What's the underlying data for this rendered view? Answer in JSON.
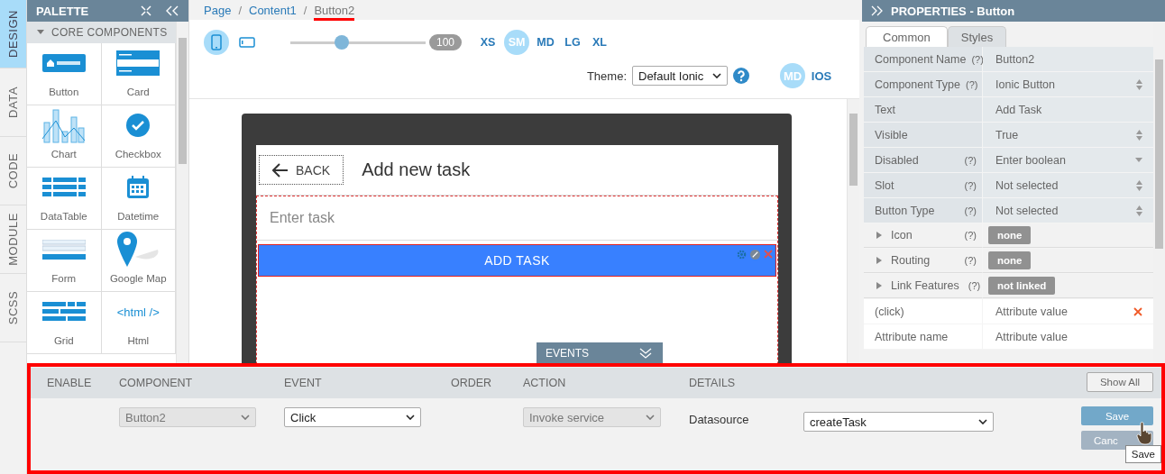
{
  "side_tabs": [
    {
      "label": "DESIGN",
      "selected": true
    },
    {
      "label": "DATA",
      "selected": false
    },
    {
      "label": "CODE",
      "selected": false
    },
    {
      "label": "MODULE",
      "selected": false
    },
    {
      "label": "SCSS",
      "selected": false
    }
  ],
  "palette": {
    "title": "PALETTE",
    "section": "CORE COMPONENTS",
    "items": [
      {
        "label": "Button",
        "kind": "button"
      },
      {
        "label": "Card",
        "kind": "card"
      },
      {
        "label": "Chart",
        "kind": "chart"
      },
      {
        "label": "Checkbox",
        "kind": "checkbox"
      },
      {
        "label": "DataTable",
        "kind": "datatable"
      },
      {
        "label": "Datetime",
        "kind": "datetime"
      },
      {
        "label": "Form",
        "kind": "form"
      },
      {
        "label": "Google Map",
        "kind": "map"
      },
      {
        "label": "Grid",
        "kind": "grid"
      },
      {
        "label": "Html",
        "kind": "html"
      }
    ],
    "html_icon_text": "<html />"
  },
  "breadcrumb": [
    {
      "label": "Page",
      "selected": false
    },
    {
      "separator": "/",
      "label": "Content1",
      "selected": false
    },
    {
      "separator": "/",
      "label": "Button2",
      "selected": true
    }
  ],
  "toolbar": {
    "zoom": {
      "level": 0.38,
      "reading": "100"
    },
    "sizes": [
      {
        "label": "XS",
        "selected": false
      },
      {
        "label": "SM",
        "selected": true
      },
      {
        "label": "MD",
        "selected": false
      },
      {
        "label": "LG",
        "selected": false
      },
      {
        "label": "XL",
        "selected": false
      }
    ],
    "theme_label": "Theme:",
    "theme": "Default Ionic",
    "modes": [
      {
        "label": "MD",
        "selected": true
      },
      {
        "label": "IOS",
        "selected": false
      }
    ]
  },
  "device": {
    "back": "BACK",
    "title": "Add new task",
    "placeholder": "Enter task",
    "button": "ADD TASK"
  },
  "events_tab": "EVENTS",
  "properties": {
    "title": "PROPERTIES - Button",
    "tabs": [
      {
        "label": "Common",
        "selected": true
      },
      {
        "label": "Styles",
        "selected": false
      }
    ],
    "rows": [
      {
        "name": "Component Name",
        "help": "(?)",
        "value": "Button2",
        "kind": "text"
      },
      {
        "name": "Component Type",
        "help": "(?)",
        "value": "Ionic Button",
        "kind": "select"
      },
      {
        "name": "Text",
        "value": "Add Task",
        "kind": "text"
      },
      {
        "name": "Visible",
        "value": "True",
        "kind": "select"
      },
      {
        "name": "Disabled",
        "help": "(?)",
        "value": "Enter boolean",
        "kind": "dropdown"
      },
      {
        "name": "Slot",
        "help": "(?)",
        "value": "Not selected",
        "kind": "select"
      },
      {
        "name": "Button Type",
        "help": "(?)",
        "value": "Not selected",
        "kind": "select"
      },
      {
        "name": "Icon",
        "help": "(?)",
        "value": "none",
        "kind": "expand"
      },
      {
        "name": "Routing",
        "help": "(?)",
        "value": "none",
        "kind": "expand"
      },
      {
        "name": "Link Features",
        "help": "(?)",
        "value": "not linked",
        "kind": "expand"
      },
      {
        "name": "(click)",
        "value": "Attribute value",
        "kind": "attribute",
        "removable": true
      },
      {
        "name": "Attribute name",
        "value": "Attribute value",
        "kind": "attribute",
        "removable": false
      }
    ]
  },
  "events": {
    "columns": [
      "ENABLE",
      "COMPONENT",
      "EVENT",
      "ORDER",
      "ACTION",
      "DETAILS"
    ],
    "show_all": "Show All",
    "row": {
      "component": "Button2",
      "event": "Click",
      "action": "Invoke service",
      "detail_label": "Datasource",
      "detail_value": "createTask"
    },
    "save": "Save",
    "cancel": "Canc",
    "tooltip": "Save"
  }
}
